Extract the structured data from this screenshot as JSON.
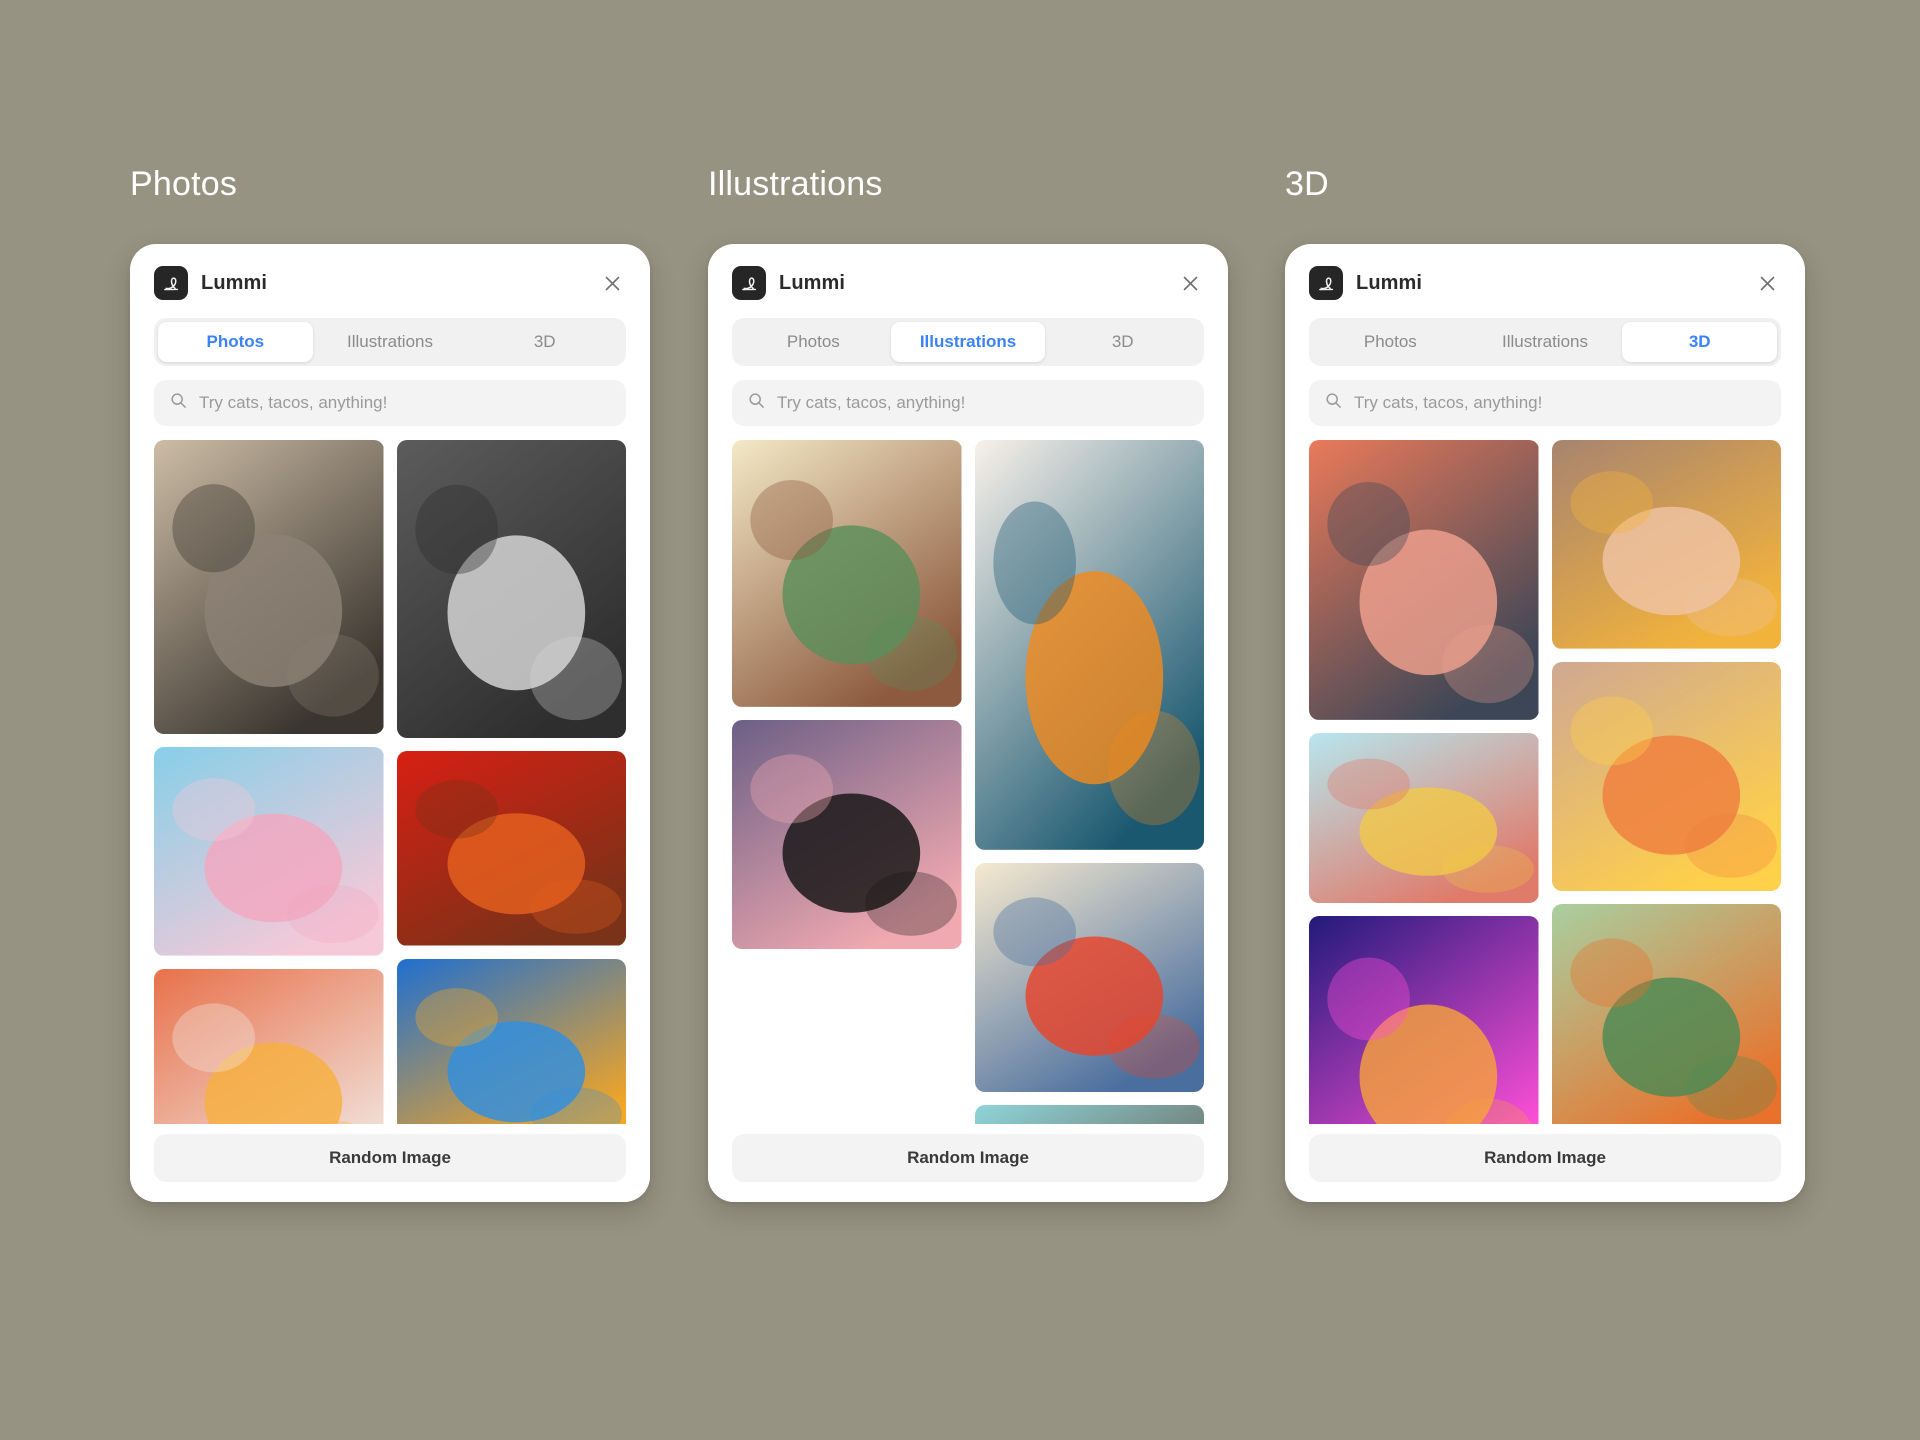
{
  "background_color": "#979382",
  "accent_color": "#3b82f6",
  "sections": [
    {
      "title": "Photos"
    },
    {
      "title": "Illustrations"
    },
    {
      "title": "3D"
    }
  ],
  "brand": {
    "name": "Lummi",
    "logo_icon": "lummi-script-l-icon"
  },
  "close_icon": "close-icon",
  "search": {
    "icon": "search-icon",
    "placeholder": "Try cats, tacos, anything!"
  },
  "tabs": [
    "Photos",
    "Illustrations",
    "3D"
  ],
  "footer": {
    "random_label": "Random Image"
  },
  "cards": [
    {
      "id": "photos-card",
      "active_tab": "Photos",
      "tiles": [
        {
          "name": "photo-plant-shadow-wall",
          "kind": "photo",
          "ratio": 0.78,
          "colors": [
            "#cdbda6",
            "#8c8175",
            "#3a352f"
          ]
        },
        {
          "name": "photo-pink-chair",
          "kind": "photo",
          "ratio": 1.1,
          "colors": [
            "#87cfe8",
            "#f3a7c0",
            "#f5c9d8"
          ]
        },
        {
          "name": "photo-peach-cocktail",
          "kind": "photo",
          "ratio": 1.0,
          "colors": [
            "#e8714b",
            "#f7b03f",
            "#f1e4dd"
          ]
        },
        {
          "name": "photo-couple-embrace-bw",
          "kind": "photo",
          "ratio": 0.77,
          "colors": [
            "#5c5c5c",
            "#d9d9d9",
            "#2e2e2e"
          ]
        },
        {
          "name": "photo-man-orange-suit",
          "kind": "photo",
          "ratio": 1.18,
          "colors": [
            "#d81f13",
            "#e5601f",
            "#7a3218"
          ]
        },
        {
          "name": "photo-blue-house",
          "kind": "photo",
          "ratio": 1.18,
          "colors": [
            "#1f6fd0",
            "#2f8fe0",
            "#f5a623"
          ]
        }
      ]
    },
    {
      "id": "illustrations-card",
      "active_tab": "Illustrations",
      "tiles": [
        {
          "name": "illustration-father-and-children",
          "kind": "illustration",
          "ratio": 0.86,
          "colors": [
            "#f3e9c6",
            "#5b8f5a",
            "#8d5a3f"
          ]
        },
        {
          "name": "illustration-person-black-hat",
          "kind": "illustration",
          "ratio": 1.0,
          "colors": [
            "#6c5f86",
            "#141414",
            "#f0a9b0"
          ]
        },
        {
          "name": "illustration-abstract-leaves-shapes",
          "kind": "illustration",
          "ratio": 0.56,
          "colors": [
            "#f8f1ea",
            "#f08a1e",
            "#1a5870"
          ]
        },
        {
          "name": "illustration-cafe-counter-people",
          "kind": "illustration",
          "ratio": 1.0,
          "colors": [
            "#f6ead0",
            "#e8442b",
            "#4a6e9e"
          ]
        },
        {
          "name": "illustration-woman-sun-hat-sea",
          "kind": "illustration",
          "ratio": 1.0,
          "colors": [
            "#8ed5da",
            "#e2a16e",
            "#5b3a2a"
          ]
        }
      ]
    },
    {
      "id": "three-d-card",
      "active_tab": "3D",
      "tiles": [
        {
          "name": "render-girl-pink-coat",
          "kind": "3d",
          "ratio": 0.82,
          "colors": [
            "#ea7a5a",
            "#f0a18d",
            "#3d4656"
          ]
        },
        {
          "name": "render-home-office-scene",
          "kind": "3d",
          "ratio": 1.35,
          "colors": [
            "#b7e6ee",
            "#f0c84a",
            "#e07a6a"
          ]
        },
        {
          "name": "render-neon-wine-glass",
          "kind": "3d",
          "ratio": 0.83,
          "colors": [
            "#211a7a",
            "#f6a13c",
            "#ff4fd8"
          ]
        },
        {
          "name": "render-ramen-bowl",
          "kind": "3d",
          "ratio": 1.1,
          "colors": [
            "#a8846f",
            "#f0c3a5",
            "#f2b33c"
          ]
        },
        {
          "name": "render-volcano-eruption",
          "kind": "3d",
          "ratio": 1.0,
          "colors": [
            "#cfa892",
            "#ef7e3e",
            "#ffd04a"
          ]
        },
        {
          "name": "render-fox-pine-forest",
          "kind": "3d",
          "ratio": 1.0,
          "colors": [
            "#a9cfa0",
            "#4c8a54",
            "#e8722c"
          ]
        },
        {
          "name": "render-teal-gradient",
          "kind": "3d",
          "ratio": 2.6,
          "colors": [
            "#7fd4c2",
            "#9fe0cf",
            "#6cc9b4"
          ]
        }
      ]
    }
  ]
}
